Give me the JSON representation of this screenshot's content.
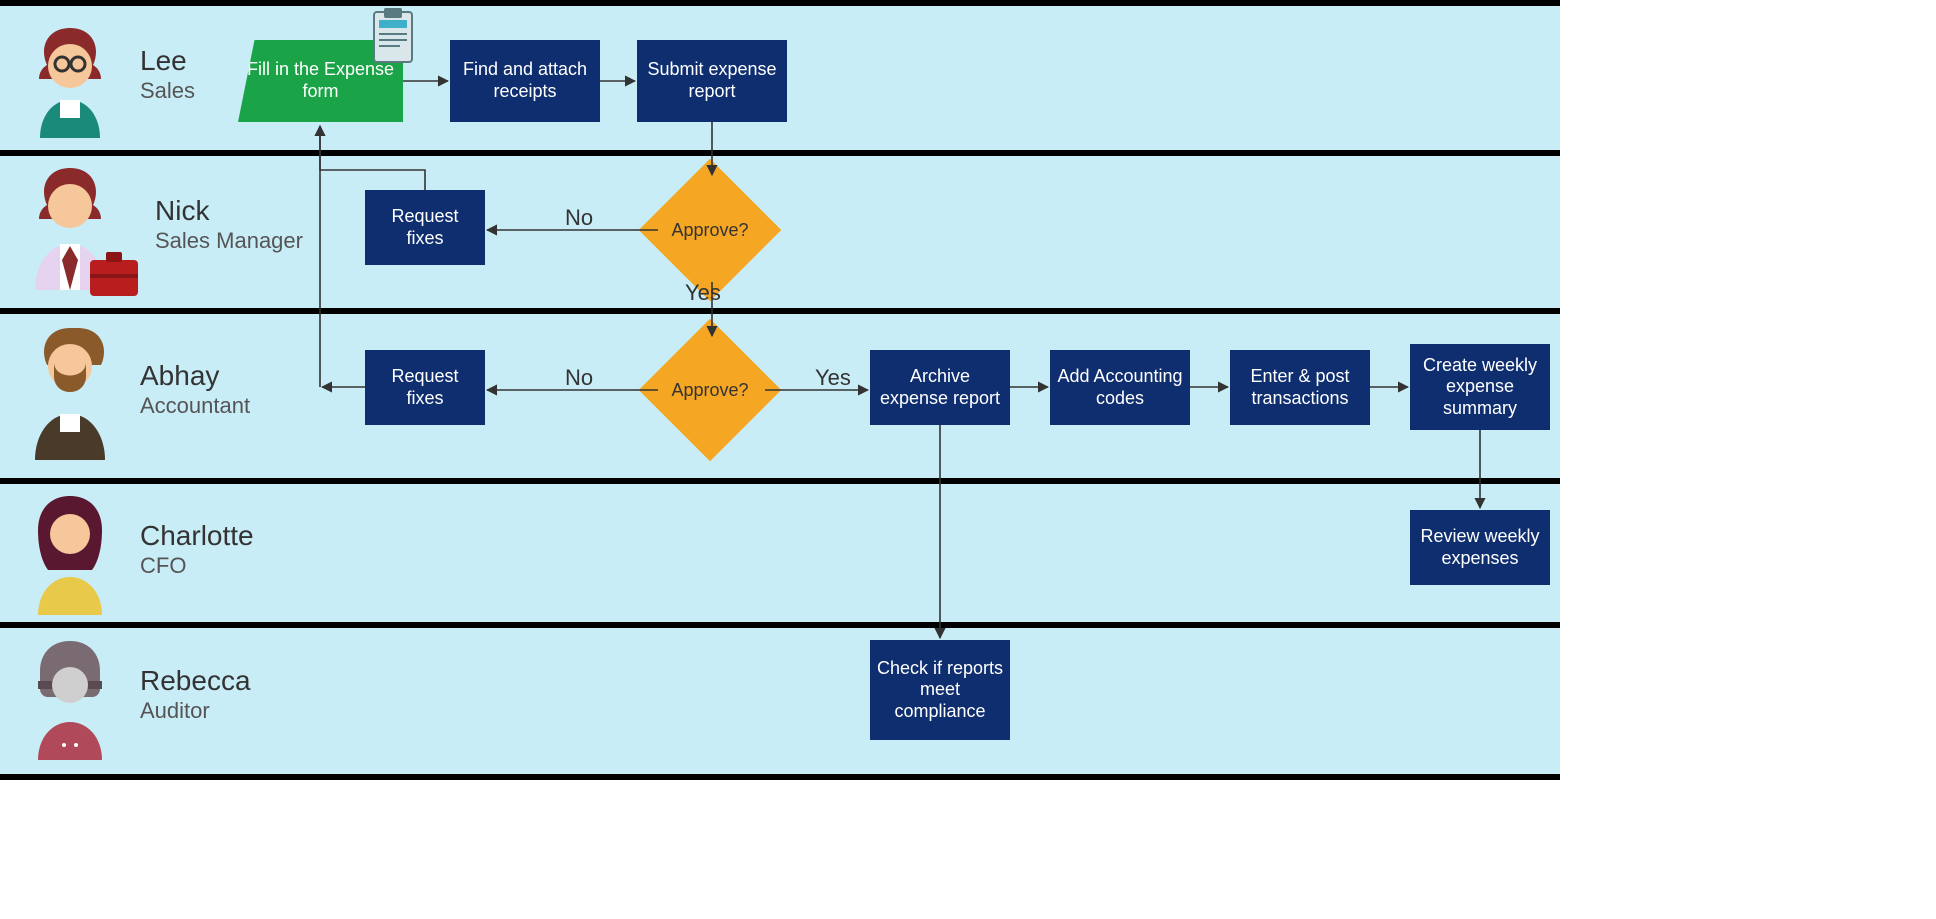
{
  "personas": [
    {
      "name": "Lee",
      "role": "Sales"
    },
    {
      "name": "Nick",
      "role": "Sales Manager"
    },
    {
      "name": "Abhay",
      "role": "Accountant"
    },
    {
      "name": "Charlotte",
      "role": "CFO"
    },
    {
      "name": "Rebecca",
      "role": "Auditor"
    }
  ],
  "steps": {
    "fill": "Fill in the Expense form",
    "find": "Find and attach receipts",
    "submit": "Submit expense report",
    "reqfix1": "Request fixes",
    "reqfix2": "Request fixes",
    "archive": "Archive expense report",
    "codes": "Add Accounting codes",
    "post": "Enter & post transactions",
    "summary": "Create weekly expense summary",
    "review": "Review weekly expenses",
    "compliance": "Check if reports meet compliance",
    "approve": "Approve?"
  },
  "labels": {
    "no": "No",
    "yes": "Yes"
  },
  "colors": {
    "lane_bg": "#c9edf7",
    "blue": "#0f2e6f",
    "green": "#1ba447",
    "orange": "#f5a623"
  }
}
